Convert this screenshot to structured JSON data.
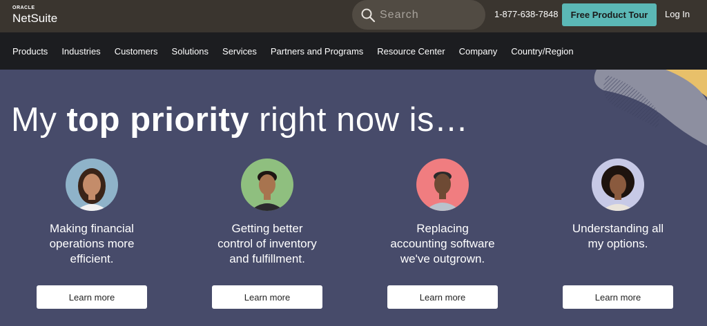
{
  "header": {
    "logo_top": "ORACLE",
    "logo_bottom": "NetSuite",
    "search_placeholder": "Search",
    "phone": "1-877-638-7848",
    "cta_label": "Free Product Tour",
    "login_label": "Log In"
  },
  "nav": {
    "items": [
      "Products",
      "Industries",
      "Customers",
      "Solutions",
      "Services",
      "Partners and Programs",
      "Resource Center",
      "Company",
      "Country/Region"
    ]
  },
  "hero": {
    "headline_prefix": "My ",
    "headline_bold": "top priority",
    "headline_suffix": " right now is…"
  },
  "cards": [
    {
      "line1": "Making financial",
      "line2": "operations more",
      "line3": "efficient.",
      "button": "Learn more",
      "avatar_bg": "#8fb3c9"
    },
    {
      "line1": "Getting better",
      "line2": "control of inventory",
      "line3": "and fulfillment.",
      "button": "Learn more",
      "avatar_bg": "#8fbf7f"
    },
    {
      "line1": "Replacing",
      "line2": "accounting software",
      "line3": "we've outgrown.",
      "button": "Learn more",
      "avatar_bg": "#f07d80"
    },
    {
      "line1": "Understanding all",
      "line2": "my options.",
      "line3": "",
      "button": "Learn more",
      "avatar_bg": "#c7c9e6"
    }
  ],
  "colors": {
    "topbar": "#3a352f",
    "navbar": "#1c1d20",
    "hero": "#474b6a",
    "cta": "#5bb8b6"
  }
}
